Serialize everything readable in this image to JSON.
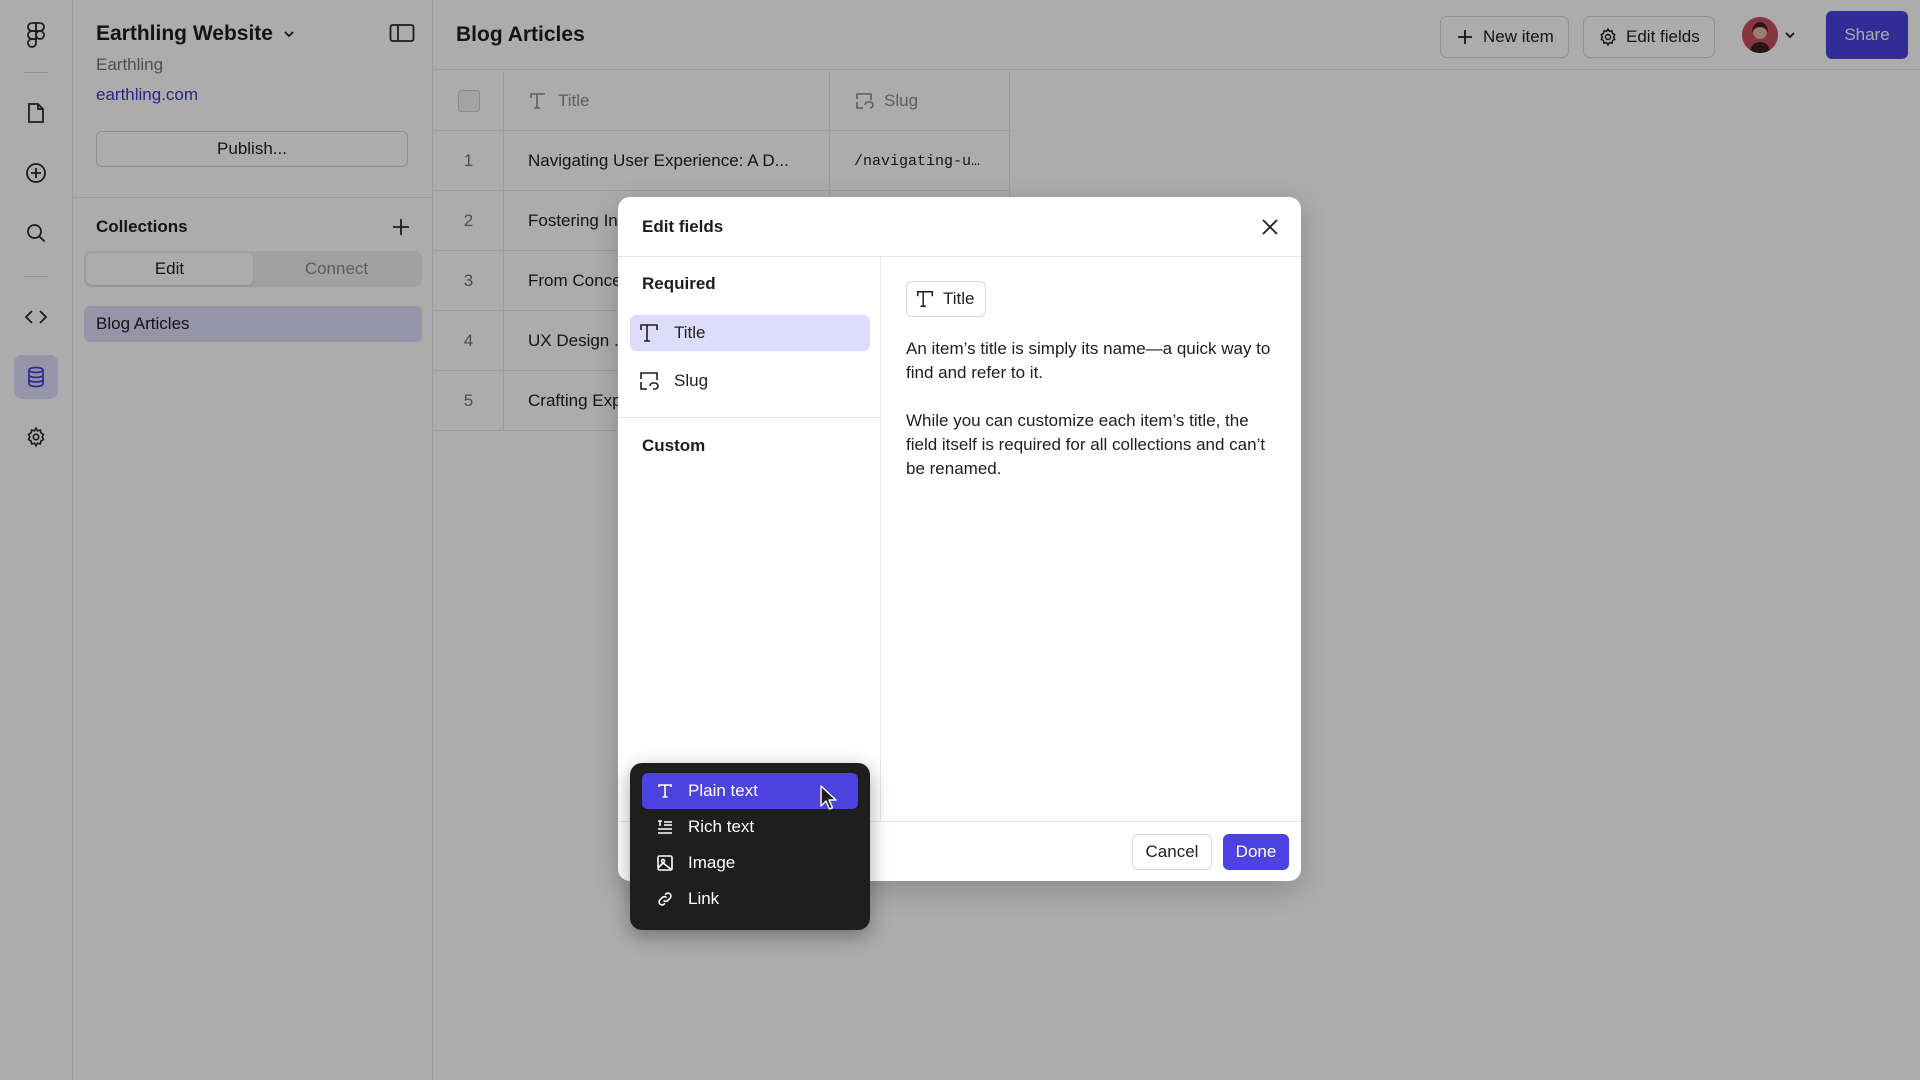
{
  "sidebar": {
    "site_name": "Earthling Website",
    "org_name": "Earthling",
    "site_url": "earthling.com",
    "publish_label": "Publish...",
    "collections_heading": "Collections",
    "tabs": [
      "Edit",
      "Connect"
    ],
    "active_tab": "Edit",
    "collections": [
      "Blog Articles"
    ]
  },
  "topbar": {
    "title": "Blog Articles",
    "new_item_label": "New item",
    "edit_fields_label": "Edit fields",
    "share_label": "Share"
  },
  "table": {
    "columns": [
      "Title",
      "Slug"
    ],
    "rows": [
      {
        "num": "1",
        "title": "Navigating User Experience: A D...",
        "slug": "/navigating-u…"
      },
      {
        "num": "2",
        "title": "Fostering In",
        "slug": ""
      },
      {
        "num": "3",
        "title": "From Conce",
        "slug": ""
      },
      {
        "num": "4",
        "title": "UX Design ...",
        "slug": ""
      },
      {
        "num": "5",
        "title": "Crafting Exp",
        "slug": ""
      }
    ]
  },
  "modal": {
    "title": "Edit fields",
    "required_heading": "Required",
    "required_fields": [
      "Title",
      "Slug"
    ],
    "selected_field": "Title",
    "custom_heading": "Custom",
    "chip_label": "Title",
    "description_1": "An item’s title is simply its name—a quick way to find and refer to it.",
    "description_2": "While you can customize each item’s title, the field itself is required for all collections and can’t be renamed.",
    "cancel_label": "Cancel",
    "done_label": "Done"
  },
  "dropdown": {
    "items": [
      {
        "label": "Plain text",
        "icon": "text-type-icon"
      },
      {
        "label": "Rich text",
        "icon": "rich-text-icon"
      },
      {
        "label": "Image",
        "icon": "image-icon"
      },
      {
        "label": "Link",
        "icon": "link-icon"
      }
    ],
    "highlighted": "Plain text"
  },
  "colors": {
    "accent": "#4b42e0",
    "selection": "#dedcfa",
    "link": "#3d36c9",
    "dropdown_bg": "#1e1e1e"
  }
}
